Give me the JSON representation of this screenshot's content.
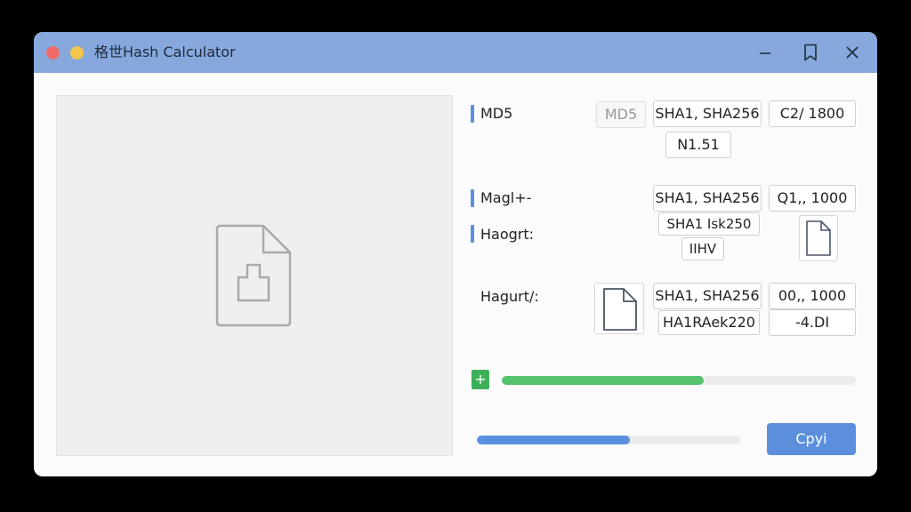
{
  "window": {
    "title": "格世Hash Calculator"
  },
  "groups": [
    {
      "label": "MD5",
      "fields": [
        {
          "value": "MD5"
        },
        {
          "value": "SHA1, SHA256"
        },
        {
          "value": "C2/ 1800"
        },
        {
          "value": "N1.51"
        }
      ]
    },
    {
      "label": "Magا+-",
      "fields": [
        {
          "value": "SHA1, SHA256"
        },
        {
          "value": "Q1,, 1000"
        }
      ]
    },
    {
      "label": "Haogrt:",
      "fields": [
        {
          "value": "SHA1 Isk250"
        },
        {
          "value": "IIHV"
        }
      ]
    },
    {
      "label": "Hagurt/:",
      "fields": [
        {
          "value": "SHA1, SHA256"
        },
        {
          "value": "00,, 1000"
        },
        {
          "value": "HA1RAek220"
        },
        {
          "value": "-4.DI"
        }
      ]
    }
  ],
  "progress": {
    "hash_fraction": 0.57,
    "file_fraction": 0.58,
    "add_label": "+"
  },
  "actions": {
    "copy_label": "Cpyi"
  },
  "colors": {
    "titlebar": "#86a8dd",
    "accent": "#5b8fdc",
    "progress_green": "#55c26e"
  }
}
